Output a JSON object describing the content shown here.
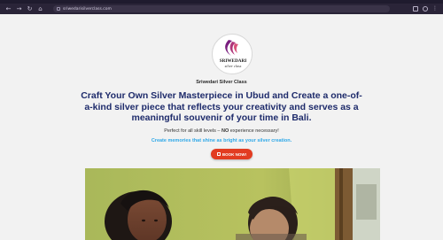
{
  "browser": {
    "url": "sriwedarisilverclass.com",
    "nav_icons": [
      "back-icon",
      "forward-icon",
      "reload-icon",
      "home-icon"
    ],
    "toolbar_icons": [
      "extensions-icon",
      "profile-icon",
      "menu-icon"
    ]
  },
  "logo": {
    "line1": "SRIWEDARI",
    "line2": "silver class"
  },
  "hero": {
    "brand_name": "Sriwedari Silver Class",
    "headline": "Craft Your Own Silver Masterpiece in Ubud and Create a one-of-a-kind silver piece that reflects your creativity and serves as a meaningful souvenir of your time in Bali.",
    "skill_prefix": "Perfect for all skill levels – ",
    "skill_emphasis": "NO",
    "skill_suffix": " experience necessary!",
    "tagline": "Create memories that shine as bright as your silver creation.",
    "book_button": "BOOK NOW!"
  },
  "photo": {
    "alt": "Two people crafting silver at a workshop"
  },
  "colors": {
    "headline": "#1e2b6b",
    "tagline": "#2fa8e8",
    "button": "#e23c21",
    "logo_accent": "#7a1f7f"
  }
}
